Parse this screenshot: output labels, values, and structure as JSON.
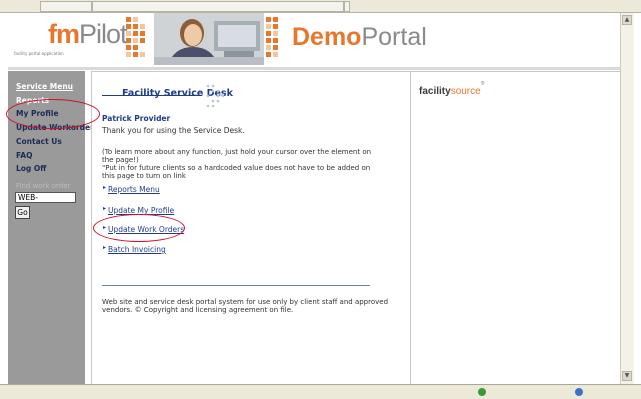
{
  "banner": {
    "fm": "fm",
    "pilot": "Pilot",
    "tagline": "facility portal application",
    "demo": "Demo",
    "portal": "Portal"
  },
  "sidebar": {
    "items": [
      {
        "label": "Service Menu"
      },
      {
        "label": "Reports"
      },
      {
        "label": "My Profile"
      },
      {
        "label": "Update Workorder"
      },
      {
        "label": "Contact Us"
      },
      {
        "label": "FAQ"
      },
      {
        "label": "Log Off"
      }
    ],
    "find_label": "Find work order",
    "work_order_value": "WEB-",
    "go_label": "Go"
  },
  "main": {
    "title": "Facility Service Desk",
    "user_name": "Patrick Provider",
    "thanks": "Thank you for using the Service Desk.",
    "help_line1": "(To learn more about any function, just hold your cursor over the element on",
    "help_line2": "the page!)",
    "help_line3": "\"Put in for future clients so a hardcoded value does not have to be added on",
    "help_line4": "this page to turn on link",
    "links": [
      {
        "label": "Reports Menu"
      },
      {
        "label": "Update My Profile"
      },
      {
        "label": "Update Work Orders"
      },
      {
        "label": "Batch Invoicing"
      }
    ],
    "footer_line1": "Web site and service desk portal system for use only by client staff and approved",
    "footer_line2": "vendors. © Copyright and licensing agreement on file."
  },
  "right": {
    "brand_bold": "facility",
    "brand_light": "source",
    "brand_mark": "®"
  },
  "colors": {
    "accent_orange": "#e8762c",
    "sidebar_gray": "#9a9a9a",
    "link_blue": "#1f3c8a",
    "highlight_red": "#d0102a"
  }
}
